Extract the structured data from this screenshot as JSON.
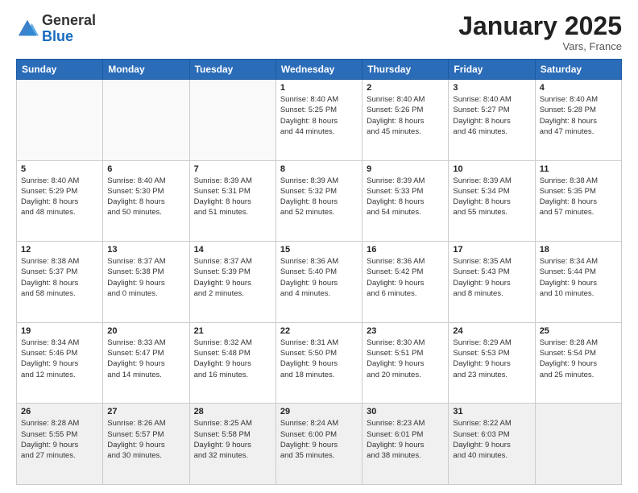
{
  "header": {
    "logo_general": "General",
    "logo_blue": "Blue",
    "month_title": "January 2025",
    "location": "Vars, France"
  },
  "weekdays": [
    "Sunday",
    "Monday",
    "Tuesday",
    "Wednesday",
    "Thursday",
    "Friday",
    "Saturday"
  ],
  "weeks": [
    [
      {
        "day": "",
        "info": ""
      },
      {
        "day": "",
        "info": ""
      },
      {
        "day": "",
        "info": ""
      },
      {
        "day": "1",
        "info": "Sunrise: 8:40 AM\nSunset: 5:25 PM\nDaylight: 8 hours\nand 44 minutes."
      },
      {
        "day": "2",
        "info": "Sunrise: 8:40 AM\nSunset: 5:26 PM\nDaylight: 8 hours\nand 45 minutes."
      },
      {
        "day": "3",
        "info": "Sunrise: 8:40 AM\nSunset: 5:27 PM\nDaylight: 8 hours\nand 46 minutes."
      },
      {
        "day": "4",
        "info": "Sunrise: 8:40 AM\nSunset: 5:28 PM\nDaylight: 8 hours\nand 47 minutes."
      }
    ],
    [
      {
        "day": "5",
        "info": "Sunrise: 8:40 AM\nSunset: 5:29 PM\nDaylight: 8 hours\nand 48 minutes."
      },
      {
        "day": "6",
        "info": "Sunrise: 8:40 AM\nSunset: 5:30 PM\nDaylight: 8 hours\nand 50 minutes."
      },
      {
        "day": "7",
        "info": "Sunrise: 8:39 AM\nSunset: 5:31 PM\nDaylight: 8 hours\nand 51 minutes."
      },
      {
        "day": "8",
        "info": "Sunrise: 8:39 AM\nSunset: 5:32 PM\nDaylight: 8 hours\nand 52 minutes."
      },
      {
        "day": "9",
        "info": "Sunrise: 8:39 AM\nSunset: 5:33 PM\nDaylight: 8 hours\nand 54 minutes."
      },
      {
        "day": "10",
        "info": "Sunrise: 8:39 AM\nSunset: 5:34 PM\nDaylight: 8 hours\nand 55 minutes."
      },
      {
        "day": "11",
        "info": "Sunrise: 8:38 AM\nSunset: 5:35 PM\nDaylight: 8 hours\nand 57 minutes."
      }
    ],
    [
      {
        "day": "12",
        "info": "Sunrise: 8:38 AM\nSunset: 5:37 PM\nDaylight: 8 hours\nand 58 minutes."
      },
      {
        "day": "13",
        "info": "Sunrise: 8:37 AM\nSunset: 5:38 PM\nDaylight: 9 hours\nand 0 minutes."
      },
      {
        "day": "14",
        "info": "Sunrise: 8:37 AM\nSunset: 5:39 PM\nDaylight: 9 hours\nand 2 minutes."
      },
      {
        "day": "15",
        "info": "Sunrise: 8:36 AM\nSunset: 5:40 PM\nDaylight: 9 hours\nand 4 minutes."
      },
      {
        "day": "16",
        "info": "Sunrise: 8:36 AM\nSunset: 5:42 PM\nDaylight: 9 hours\nand 6 minutes."
      },
      {
        "day": "17",
        "info": "Sunrise: 8:35 AM\nSunset: 5:43 PM\nDaylight: 9 hours\nand 8 minutes."
      },
      {
        "day": "18",
        "info": "Sunrise: 8:34 AM\nSunset: 5:44 PM\nDaylight: 9 hours\nand 10 minutes."
      }
    ],
    [
      {
        "day": "19",
        "info": "Sunrise: 8:34 AM\nSunset: 5:46 PM\nDaylight: 9 hours\nand 12 minutes."
      },
      {
        "day": "20",
        "info": "Sunrise: 8:33 AM\nSunset: 5:47 PM\nDaylight: 9 hours\nand 14 minutes."
      },
      {
        "day": "21",
        "info": "Sunrise: 8:32 AM\nSunset: 5:48 PM\nDaylight: 9 hours\nand 16 minutes."
      },
      {
        "day": "22",
        "info": "Sunrise: 8:31 AM\nSunset: 5:50 PM\nDaylight: 9 hours\nand 18 minutes."
      },
      {
        "day": "23",
        "info": "Sunrise: 8:30 AM\nSunset: 5:51 PM\nDaylight: 9 hours\nand 20 minutes."
      },
      {
        "day": "24",
        "info": "Sunrise: 8:29 AM\nSunset: 5:53 PM\nDaylight: 9 hours\nand 23 minutes."
      },
      {
        "day": "25",
        "info": "Sunrise: 8:28 AM\nSunset: 5:54 PM\nDaylight: 9 hours\nand 25 minutes."
      }
    ],
    [
      {
        "day": "26",
        "info": "Sunrise: 8:28 AM\nSunset: 5:55 PM\nDaylight: 9 hours\nand 27 minutes."
      },
      {
        "day": "27",
        "info": "Sunrise: 8:26 AM\nSunset: 5:57 PM\nDaylight: 9 hours\nand 30 minutes."
      },
      {
        "day": "28",
        "info": "Sunrise: 8:25 AM\nSunset: 5:58 PM\nDaylight: 9 hours\nand 32 minutes."
      },
      {
        "day": "29",
        "info": "Sunrise: 8:24 AM\nSunset: 6:00 PM\nDaylight: 9 hours\nand 35 minutes."
      },
      {
        "day": "30",
        "info": "Sunrise: 8:23 AM\nSunset: 6:01 PM\nDaylight: 9 hours\nand 38 minutes."
      },
      {
        "day": "31",
        "info": "Sunrise: 8:22 AM\nSunset: 6:03 PM\nDaylight: 9 hours\nand 40 minutes."
      },
      {
        "day": "",
        "info": ""
      }
    ]
  ]
}
